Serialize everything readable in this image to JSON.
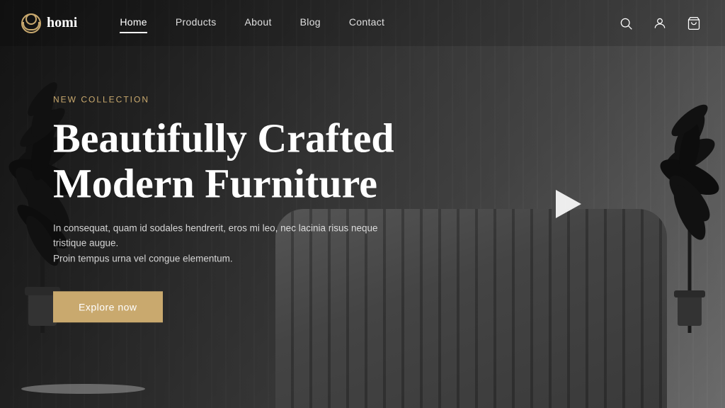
{
  "brand": {
    "name": "homi",
    "logo_icon_label": "homi-logo"
  },
  "nav": {
    "links": [
      {
        "label": "Home",
        "id": "home",
        "active": true
      },
      {
        "label": "Products",
        "id": "products",
        "active": false
      },
      {
        "label": "About",
        "id": "about",
        "active": false
      },
      {
        "label": "Blog",
        "id": "blog",
        "active": false
      },
      {
        "label": "Contact",
        "id": "contact",
        "active": false
      }
    ],
    "icons": {
      "search_label": "Search",
      "account_label": "Account",
      "cart_label": "Cart"
    }
  },
  "hero": {
    "badge": "NEW COLLECTION",
    "title_line1": "Beautifully Crafted",
    "title_line2": "Modern Furniture",
    "description_line1": "In consequat, quam id sodales hendrerit, eros mi leo, nec lacinia risus neque tristique augue.",
    "description_line2": "Proin tempus urna vel congue elementum.",
    "cta_label": "Explore now",
    "play_label": "Play video"
  },
  "colors": {
    "accent": "#c9a96e",
    "text_primary": "#ffffff",
    "text_secondary": "rgba(255,255,255,0.8)",
    "nav_bg": "rgba(0,0,0,0.15)",
    "hero_overlay": "rgba(0,0,0,0.4)"
  }
}
